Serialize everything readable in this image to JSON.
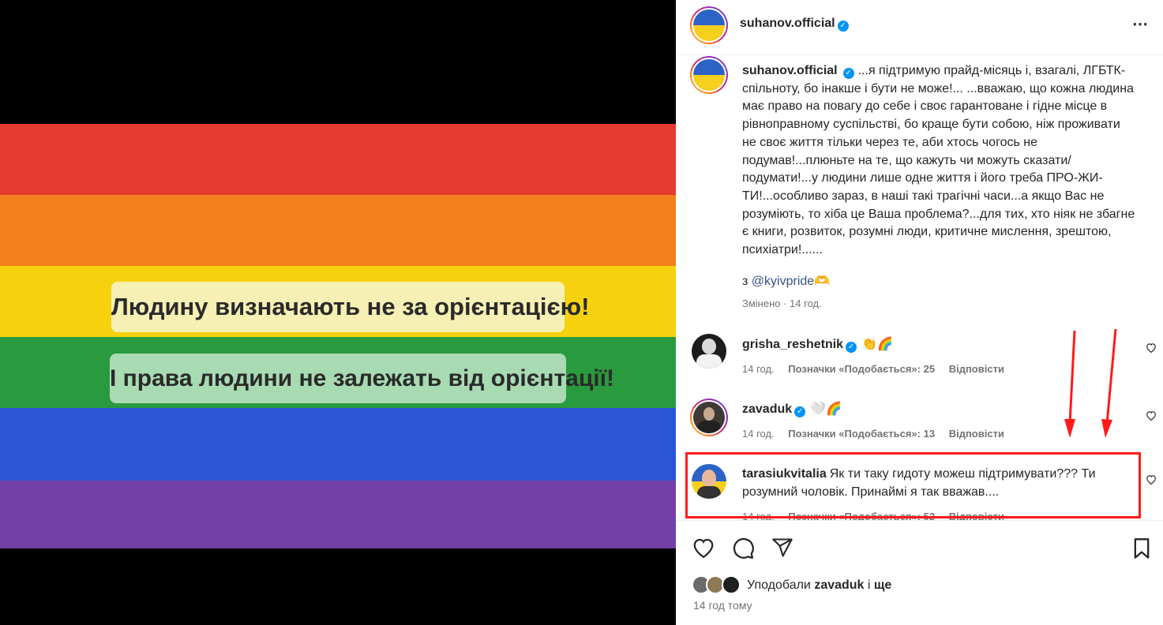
{
  "media": {
    "stripe_colors": [
      "#e43a30",
      "#f2801c",
      "#f6d20e",
      "#2a9a3e",
      "#2b55d4",
      "#7241a7"
    ],
    "banner_1_text": "Людину визначають не за орієнтацією!",
    "banner_1_bg": "#f6f0b4",
    "banner_2_text": "І права людини не залежать від орієнтації!",
    "banner_2_bg": "#a8dbb2"
  },
  "header": {
    "username": "suhanov.official",
    "more_icon": "⋯"
  },
  "caption": {
    "username": "suhanov.official",
    "text": "...я підтримую прайд-місяць і, взагалі, ЛГБТК-спільноту, бо інакше і бути не може!... ...вважаю, що кожна людина має право на повагу до себе і своє гарантоване і гідне місце в рівноправному суспільстві, бо краще бути собою, ніж проживати не своє життя тільки через те, аби хтось чогось не подумав!...плюньте на те, що кажуть чи можуть сказати/подумати!...у людини лише одне життя і його треба ПРО-ЖИ-ТИ!...особливо зараз, в наші такі трагічні часи...а якщо Вас не розуміють, то хіба це Ваша проблема?...для тих, хто ніяк не збагне є книги, розвиток, розумні люди, критичне мислення, зрештою, психіатри!......",
    "mention_prefix": "з",
    "mention": "@kyivpride",
    "mention_emoji": "🫶",
    "meta": "Змінено · 14 год."
  },
  "comments": [
    {
      "username": "grisha_reshetnik",
      "verified": true,
      "text": "👏🌈",
      "time": "14 год.",
      "likes": "Позначки «Подобається»: 25",
      "reply": "Відповісти"
    },
    {
      "username": "zavaduk",
      "verified": true,
      "text": "🤍🌈",
      "time": "14 год.",
      "likes": "Позначки «Подобається»: 13",
      "reply": "Відповісти"
    },
    {
      "username": "tarasiukvitalia",
      "verified": false,
      "text": "Як ти таку гидоту можеш підтримувати??? Ти розумний чоловік. Принаймі я так вважав....",
      "time": "14 год.",
      "likes": "Позначки «Подобається»: 52",
      "reply": "Відповісти"
    }
  ],
  "footer": {
    "liked_prefix": "Уподобали",
    "liked_user": "zavaduk",
    "liked_and": "і",
    "liked_more": "ще",
    "time_ago": "14 год тому"
  },
  "icons": {
    "like": "heart-icon",
    "comment": "comment-icon",
    "share": "share-icon",
    "save": "bookmark-icon"
  },
  "annotation_color": "#ff1a1a"
}
